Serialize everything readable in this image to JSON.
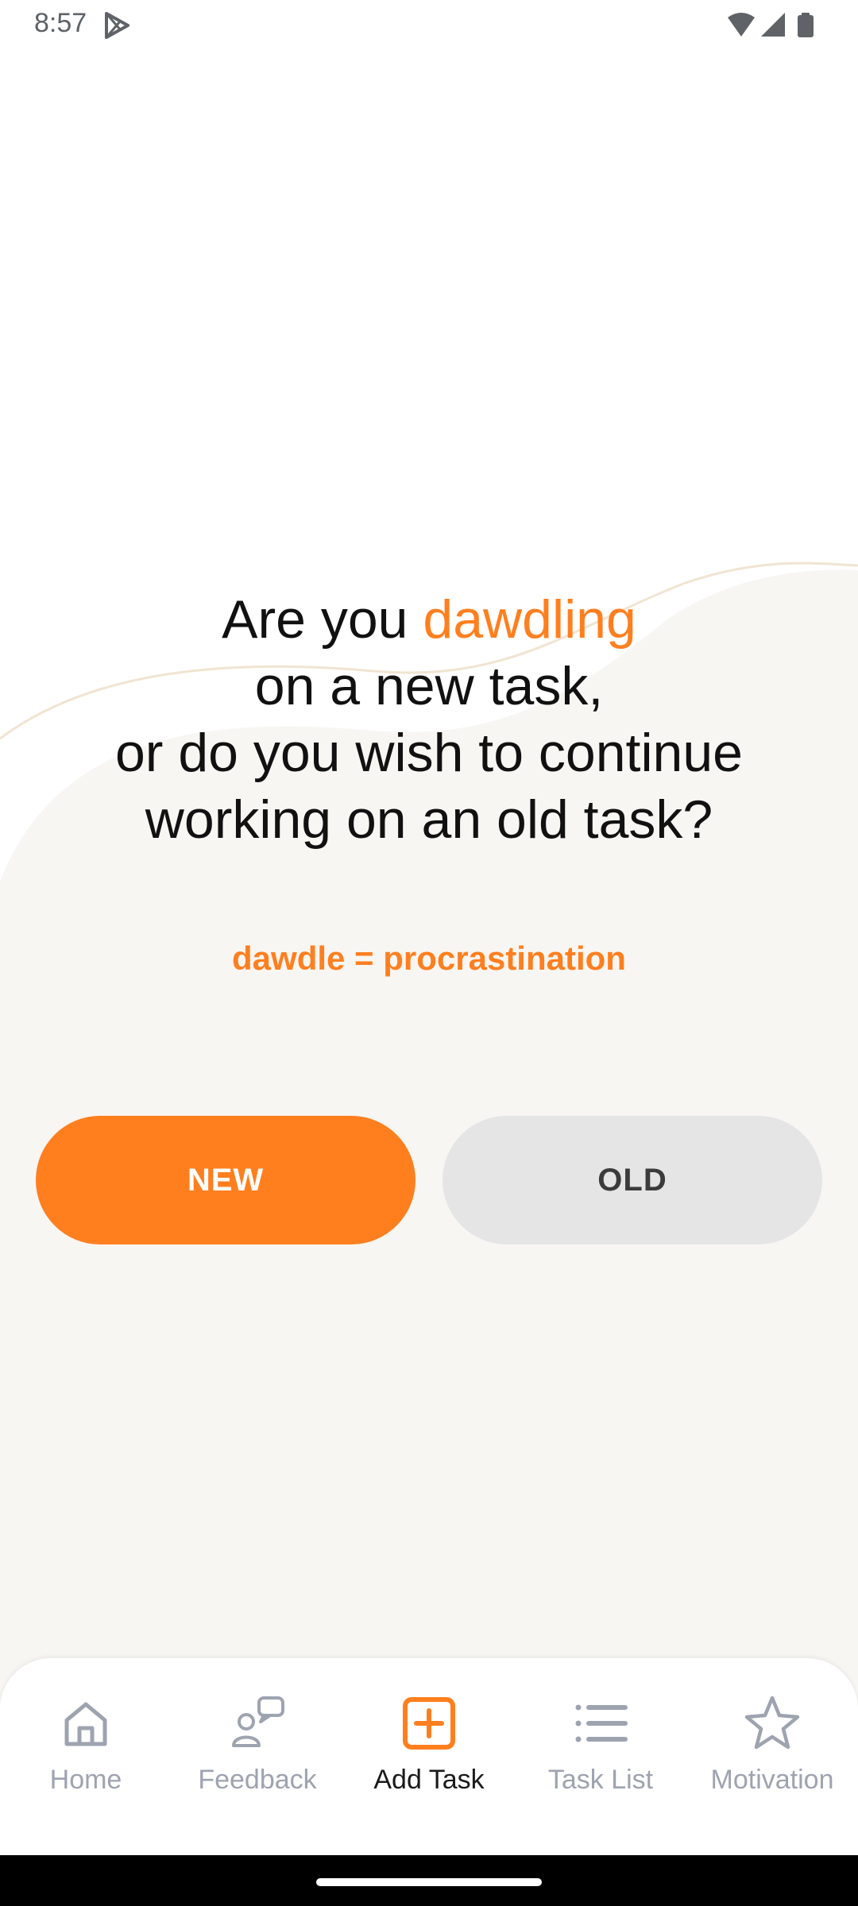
{
  "status_bar": {
    "time": "8:57",
    "play_icon": "play-store-icon",
    "wifi_icon": "wifi-icon",
    "signal_icon": "signal-icon",
    "battery_icon": "battery-icon"
  },
  "question": {
    "part1": "Are you ",
    "highlight": "dawdling",
    "part2": "on a new task,",
    "part3": "or do you wish to continue",
    "part4": "working on an old task?"
  },
  "definition": "dawdle = procrastination",
  "buttons": {
    "new_label": "NEW",
    "old_label": "OLD"
  },
  "bottom_nav": {
    "items": [
      {
        "label": "Home",
        "icon": "home-icon",
        "active": false
      },
      {
        "label": "Feedback",
        "icon": "feedback-icon",
        "active": false
      },
      {
        "label": "Add Task",
        "icon": "add-task-icon",
        "active": true
      },
      {
        "label": "Task List",
        "icon": "list-icon",
        "active": false
      },
      {
        "label": "Motivation",
        "icon": "star-icon",
        "active": false
      }
    ]
  },
  "colors": {
    "accent": "#ff7f1f",
    "background_cream": "#f8f6f2",
    "button_secondary": "#e5e5e5",
    "nav_inactive": "#9ea3b0",
    "nav_active": "#1a1a1a"
  }
}
